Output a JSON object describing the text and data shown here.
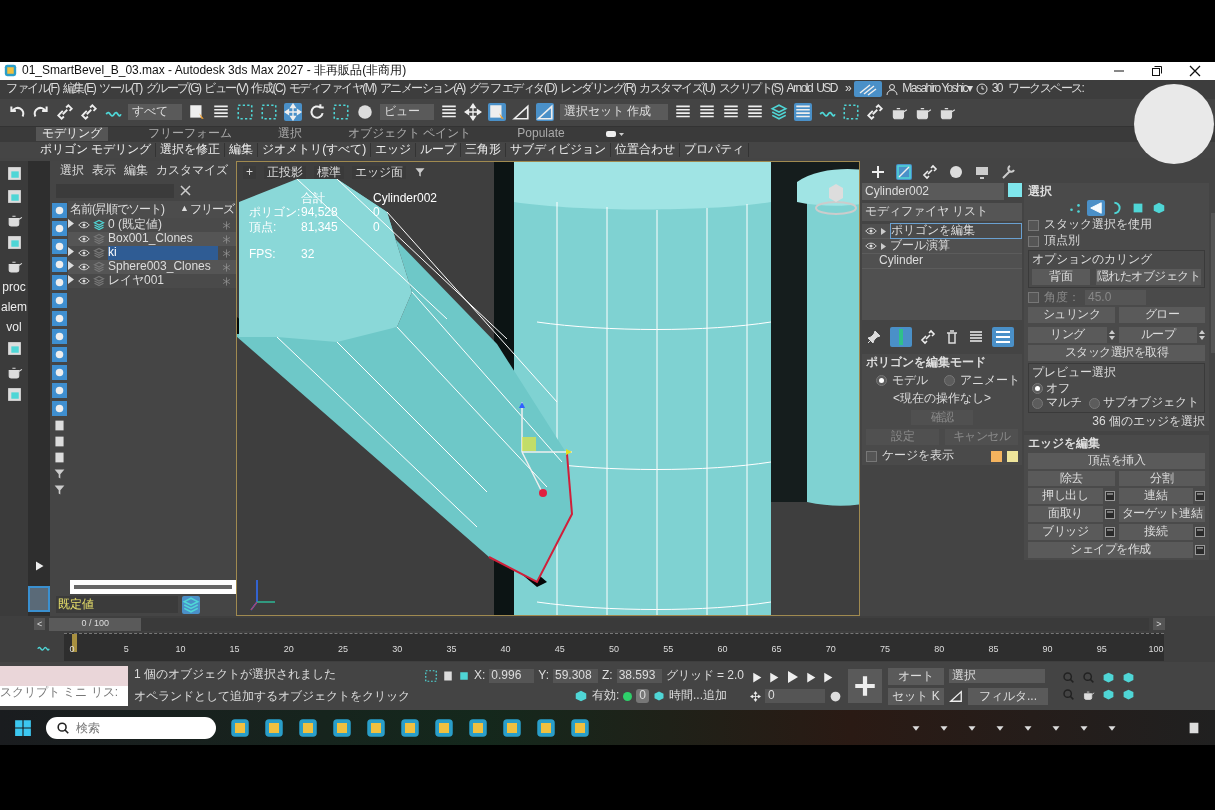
{
  "title_bar": {
    "title": "01_SmartBevel_B_03.max - Autodesk 3ds Max 2027  - 非再販品(非商用)"
  },
  "menu_bar": {
    "items": [
      "ファイル(F)",
      "編集(E)",
      "ツール(T)",
      "グループ(G)",
      "ビュー(V)",
      "作成(C)",
      "モディファイヤ(M)",
      "アニメーション(A)",
      "グラフ エディタ(D)",
      "レンダリング(R)",
      "カスタマイズ(U)",
      "スクリプト(S)",
      "Arnold",
      "USD"
    ],
    "overflow": "»",
    "user": "Masahiro Yoshic▾",
    "clock_count": "30",
    "workspace_label": "ワークスペース:"
  },
  "toolbar": {
    "filter_dropdown": "すべて",
    "coord_dropdown": "ビュー",
    "selection_set": "選択セット 作成"
  },
  "ribbon": {
    "tabs": [
      {
        "label": "モデリング",
        "selected": true
      },
      {
        "label": "フリーフォーム",
        "selected": false
      },
      {
        "label": "選択",
        "selected": false
      },
      {
        "label": "オブジェクト ペイント",
        "selected": false
      },
      {
        "label": "Populate",
        "selected": false
      }
    ],
    "panels": [
      "ポリゴン モデリング",
      "選択を修正",
      "編集",
      "ジオメトリ(すべて)",
      "エッジ",
      "ループ",
      "三角形",
      "サブディビジョン",
      "位置合わせ",
      "プロパティ"
    ]
  },
  "left_toolbar": {
    "labels": [
      "proc",
      "alem",
      "vol"
    ]
  },
  "scene_explorer": {
    "menus": [
      "選択",
      "表示",
      "編集",
      "カスタマイズ"
    ],
    "columns": [
      "名前(昇順でソート)",
      "フリーズ"
    ],
    "sort_indicator": "▲",
    "rows": [
      {
        "name": "0 (既定値)",
        "kind": "current-layer",
        "expandable": true,
        "selected": false
      },
      {
        "name": "Box001_Clones",
        "kind": "layer",
        "expandable": false,
        "selected": false
      },
      {
        "name": "ki",
        "kind": "layer",
        "expandable": true,
        "selected": true
      },
      {
        "name": "Sphere003_Clones",
        "kind": "layer",
        "expandable": true,
        "selected": false
      },
      {
        "name": "レイヤ001",
        "kind": "layer",
        "expandable": true,
        "selected": false
      }
    ],
    "current_layer": "既定値"
  },
  "viewport": {
    "labels": [
      "+",
      "正投影",
      "標準",
      "エッジ面"
    ],
    "stats": {
      "headers": [
        "合計",
        "Cylinder002"
      ],
      "rows": [
        {
          "label": "ポリゴン:",
          "total": "94,528",
          "selected": "0"
        },
        {
          "label": "頂点:",
          "total": "81,345",
          "selected": "0"
        }
      ],
      "fps_label": "FPS:",
      "fps": "32"
    }
  },
  "command_panel": {
    "object_name": "Cylinder002",
    "modifier_list": "モディファイヤ リスト",
    "stack": [
      {
        "label": "ポリゴンを編集",
        "kind": "modifier",
        "selected": true
      },
      {
        "label": "ブール演算",
        "kind": "modifier",
        "selected": false
      },
      {
        "label": "Cylinder",
        "kind": "base",
        "selected": false
      }
    ],
    "edit_poly_mode": {
      "title": "ポリゴンを編集モード",
      "modes": [
        {
          "label": "モデル",
          "selected": true
        },
        {
          "label": "アニメート",
          "selected": false
        }
      ],
      "current_op": "<現在の操作なし>",
      "buttons": [
        {
          "label": "確認",
          "disabled": true
        },
        {
          "label": "設定",
          "disabled": true
        },
        {
          "label": "キャンセル",
          "disabled": true
        }
      ],
      "show_cage": {
        "label": "ケージを表示",
        "checked": false
      },
      "cage_swatches": [
        {
          "color": "#f4b35e"
        },
        {
          "color": "#efe59a"
        }
      ]
    },
    "selection": {
      "title": "選択",
      "subobjects": [
        {
          "kind": "vertex",
          "selected": false
        },
        {
          "kind": "edge",
          "selected": true
        },
        {
          "kind": "border",
          "selected": false
        },
        {
          "kind": "polygon",
          "selected": false
        },
        {
          "kind": "element",
          "selected": false
        }
      ],
      "checkboxes": [
        {
          "label": "スタック選択を使用",
          "checked": false
        },
        {
          "label": "頂点別",
          "checked": false
        }
      ],
      "culling": {
        "title": "オプションのカリング",
        "buttons": [
          "背面",
          "隠れたオブジェクト"
        ]
      },
      "angle": {
        "label": "角度：",
        "value": "45.0",
        "disabled": true,
        "checked": false
      },
      "buttons": [
        {
          "label": "シュリンク",
          "spinner": false
        },
        {
          "label": "グロー",
          "spinner": false
        },
        {
          "label": "リング",
          "spinner": true
        },
        {
          "label": "ループ",
          "spinner": true
        }
      ],
      "get_stack": "スタック選択を取得",
      "preview": {
        "title": "プレビュー選択",
        "options": [
          {
            "label": "オフ",
            "selected": true
          },
          {
            "label": "マルチ",
            "selected": false
          },
          {
            "label": "サブオブジェクト",
            "selected": false
          }
        ]
      },
      "summary": "36 個のエッジを選択"
    },
    "edit_edges": {
      "title": "エッジを編集",
      "rows": [
        [
          {
            "label": "頂点を挿入",
            "settings": false
          }
        ],
        [
          {
            "label": "除去",
            "settings": false
          },
          {
            "label": "分割",
            "settings": false
          }
        ],
        [
          {
            "label": "押し出し",
            "settings": true
          },
          {
            "label": "連結",
            "settings": true
          }
        ],
        [
          {
            "label": "面取り",
            "settings": true
          },
          {
            "label": "ターゲット連結",
            "settings": false
          }
        ],
        [
          {
            "label": "ブリッジ",
            "settings": true
          },
          {
            "label": "接続",
            "settings": true
          }
        ],
        [
          {
            "label": "シェイプを作成",
            "settings": true
          }
        ]
      ]
    }
  },
  "timeline": {
    "range": "0 / 100",
    "level": 0,
    "prev": "<",
    "next": ">",
    "ticks": [
      "0",
      "5",
      "10",
      "15",
      "20",
      "25",
      "30",
      "35",
      "40",
      "45",
      "50",
      "55",
      "60",
      "65",
      "70",
      "75",
      "80",
      "85",
      "90",
      "95",
      "100"
    ]
  },
  "status": {
    "listener": "スクリプト ミニ リス:",
    "messages": [
      "1 個のオブジェクトが選択されました",
      "オペランドとして追加するオブジェクトをクリック"
    ],
    "coords": [
      {
        "axis": "X:",
        "value": "0.996"
      },
      {
        "axis": "Y:",
        "value": "59.308"
      },
      {
        "axis": "Z:",
        "value": "38.593"
      }
    ],
    "grid": "グリッド = 2.0",
    "enabled_label": "有効:",
    "enabled_value": "0",
    "time_tag": "時間...追加",
    "frame": "0",
    "key_buttons": [
      "オート",
      "セット K"
    ],
    "key_set": "選択",
    "filters": "フィルタ..."
  },
  "taskbar": {
    "search_placeholder": "検索"
  }
}
